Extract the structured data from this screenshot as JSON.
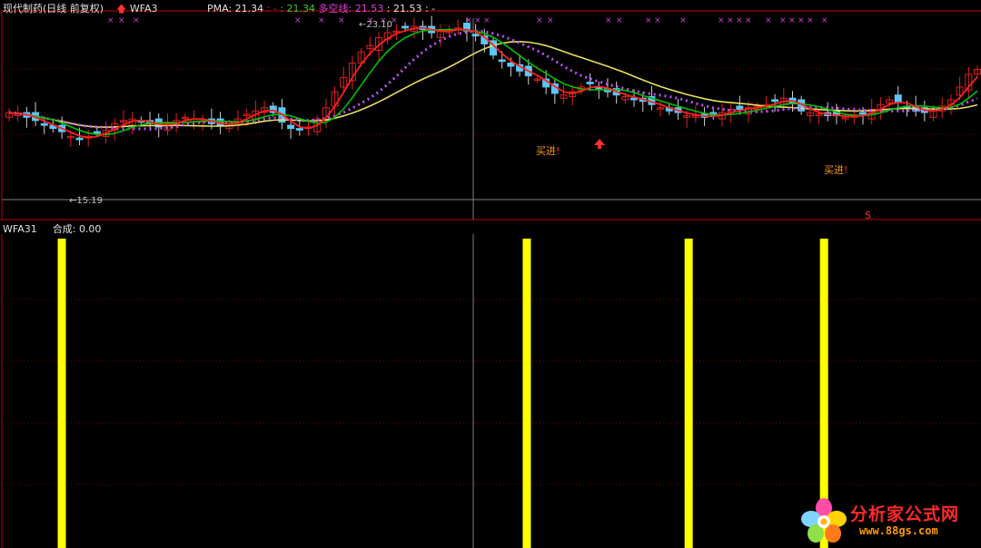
{
  "header": {
    "stock_title": "现代制药(日线 前复权)",
    "indicator_name": "WFA3",
    "pma_label": "PMA:",
    "pma_value": "21.34",
    "sep1": ": -",
    "sep2": ": 21.34",
    "dkx_label": "多空线:",
    "dkx_value": "21.53",
    "sep3": ": 21.53",
    "sep4": ": -"
  },
  "annotations": {
    "high_price": "23.10",
    "low_price": "15.19",
    "buy_label": "买进",
    "buy_mark": "!",
    "sell_mark": "S"
  },
  "sub_panel": {
    "name": "WFA31",
    "value_label": "合成:",
    "value": "0.00"
  },
  "watermark": {
    "text": "分析家公式网",
    "url": "www.88gs.com"
  },
  "colors": {
    "background": "#000000",
    "border": "#c00000",
    "up_candle": "#e02020",
    "down_candle": "#5ac8fa",
    "ma_short": "#ff2020",
    "ma_mid": "#00c000",
    "ma_long": "#e8e060",
    "dkx": "#c050ff",
    "signal_bar": "#ffff00",
    "marker": "#d040d0"
  },
  "chart_data": {
    "type": "candlestick",
    "price_series": [
      20.0,
      19.9,
      19.7,
      19.5,
      19.2,
      19.0,
      18.8,
      18.5,
      18.3,
      18.5,
      18.7,
      18.9,
      19.3,
      19.5,
      19.6,
      19.4,
      19.3,
      19.1,
      19.3,
      19.5,
      19.7,
      19.6,
      19.5,
      19.3,
      19.2,
      19.3,
      19.6,
      19.9,
      20.1,
      20.3,
      20.0,
      19.4,
      19.0,
      18.9,
      19.1,
      19.6,
      20.3,
      21.3,
      22.2,
      23.1,
      23.8,
      24.2,
      24.7,
      25.0,
      25.1,
      25.3,
      25.4,
      25.2,
      25.0,
      25.1,
      25.2,
      25.3,
      25.1,
      24.8,
      24.3,
      23.6,
      23.2,
      22.9,
      22.6,
      22.3,
      22.1,
      21.6,
      21.2,
      21.1,
      21.3,
      21.6,
      21.8,
      21.5,
      21.3,
      21.1,
      21.0,
      20.8,
      20.7,
      20.5,
      20.3,
      20.1,
      20.0,
      19.8,
      19.8,
      19.7,
      19.8,
      20.0,
      20.2,
      20.2,
      20.3,
      20.4,
      20.5,
      20.7,
      20.9,
      20.6,
      20.1,
      20.0,
      19.9,
      19.8,
      19.8,
      19.7,
      19.8,
      19.9,
      20.2,
      20.5,
      20.8,
      20.6,
      20.4,
      20.1,
      20.0,
      20.2,
      20.4,
      20.8,
      21.6,
      22.4,
      22.7
    ],
    "buy_signal_days": [
      74,
      105
    ],
    "signal_bar_positions": [
      0.063,
      0.537,
      0.702,
      0.84
    ],
    "subpanel_value": 0.0
  }
}
